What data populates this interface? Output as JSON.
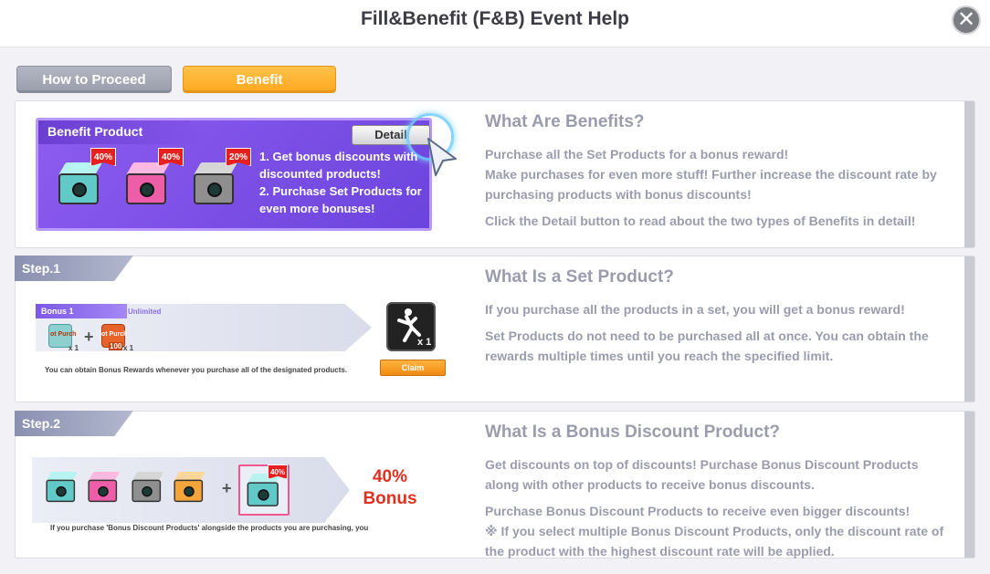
{
  "header": {
    "title": "Fill&Benefit (F&B) Event Help",
    "close_symbol": "✕"
  },
  "tabs": [
    {
      "label": "How to Proceed",
      "active": false
    },
    {
      "label": "Benefit",
      "active": true
    }
  ],
  "sections": {
    "benefits": {
      "heading": "What Are Benefits?",
      "paragraphs": [
        "Purchase all the Set Products for a bonus reward!\nMake purchases for even more stuff! Further increase the discount rate by purchasing products with bonus discounts!",
        "Click the Detail button to read about the two types of Benefits in detail!"
      ],
      "card": {
        "header": "Benefit Product",
        "detail_button": "Detail",
        "discounts": [
          "40%",
          "40%",
          "20%"
        ],
        "text": "1. Get bonus discounts with discounted products!\n2. Purchase Set Products for even more bonuses!"
      }
    },
    "set_product": {
      "step_label": "Step.1",
      "heading": "What Is a Set Product?",
      "paragraphs": [
        "If you purchase all the products in a set, you will get a bonus reward!",
        "Set Products do not need to be purchased all at once. You can obtain the rewards multiple times until you reach the specified limit."
      ],
      "illustration": {
        "bonus_label": "Bonus 1",
        "limit_label": "Unlimited",
        "item1_text": "ot Purch",
        "item1_count": "x 1",
        "item2_text": "ot Purch",
        "item2_count": "x 1",
        "item2_badge": "100",
        "reward_count": "x 1",
        "caption": "You can obtain Bonus Rewards whenever you purchase all of the designated products.",
        "claim_button": "Claim"
      }
    },
    "bonus_discount": {
      "step_label": "Step.2",
      "heading": "What Is a Bonus Discount Product?",
      "paragraphs": [
        "Get discounts on top of discounts! Purchase Bonus Discount Products along with other products to receive bonus discounts.",
        "Purchase Bonus Discount Products to receive even bigger discounts!\n※ If you select multiple Bonus Discount Products, only the discount rate of the product with the highest discount rate will be applied."
      ],
      "illustration": {
        "tag": "40%",
        "result_pct": "40%",
        "result_label": "Bonus",
        "caption": "If you purchase 'Bonus Discount Products' alongside the products you are purchasing, you"
      }
    }
  },
  "colors": {
    "accent_orange": "#ffa820",
    "card_purple": "#7a4fe6",
    "heading_gray": "#9a9cae",
    "bonus_red": "#e03020"
  }
}
